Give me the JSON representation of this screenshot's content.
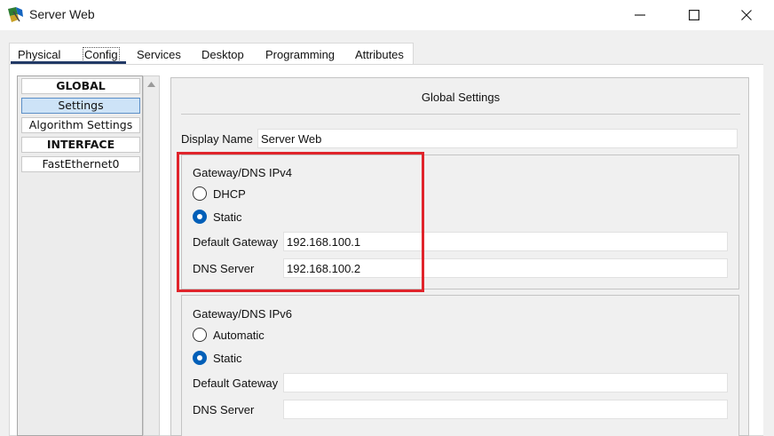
{
  "window": {
    "title": "Server Web",
    "icon": "packet-tracer-server-icon",
    "controls": {
      "minimize": "minimize-icon",
      "maximize": "maximize-icon",
      "close": "close-icon"
    }
  },
  "tabs": [
    "Physical",
    "Config",
    "Services",
    "Desktop",
    "Programming",
    "Attributes"
  ],
  "active_tab": "Config",
  "nav": {
    "items": [
      {
        "label": "GLOBAL",
        "type": "header"
      },
      {
        "label": "Settings",
        "type": "item",
        "selected": true
      },
      {
        "label": "Algorithm Settings",
        "type": "item"
      },
      {
        "label": "INTERFACE",
        "type": "header"
      },
      {
        "label": "FastEthernet0",
        "type": "item"
      }
    ]
  },
  "settings": {
    "title": "Global Settings",
    "display_name": {
      "label": "Display Name",
      "value": "Server Web"
    },
    "ipv4": {
      "title": "Gateway/DNS IPv4",
      "options": [
        "DHCP",
        "Static"
      ],
      "selected": "Static",
      "gateway": {
        "label": "Default Gateway",
        "value": "192.168.100.1"
      },
      "dns": {
        "label": "DNS Server",
        "value": "192.168.100.2"
      }
    },
    "ipv6": {
      "title": "Gateway/DNS IPv6",
      "options": [
        "Automatic",
        "Static"
      ],
      "selected": "Static",
      "gateway": {
        "label": "Default Gateway",
        "value": ""
      },
      "dns": {
        "label": "DNS Server",
        "value": ""
      }
    }
  },
  "colors": {
    "highlight_border": "#e0242b",
    "tab_underline": "#223a66",
    "radio_checked": "#005fb8",
    "nav_selected": "#cde3f7"
  }
}
